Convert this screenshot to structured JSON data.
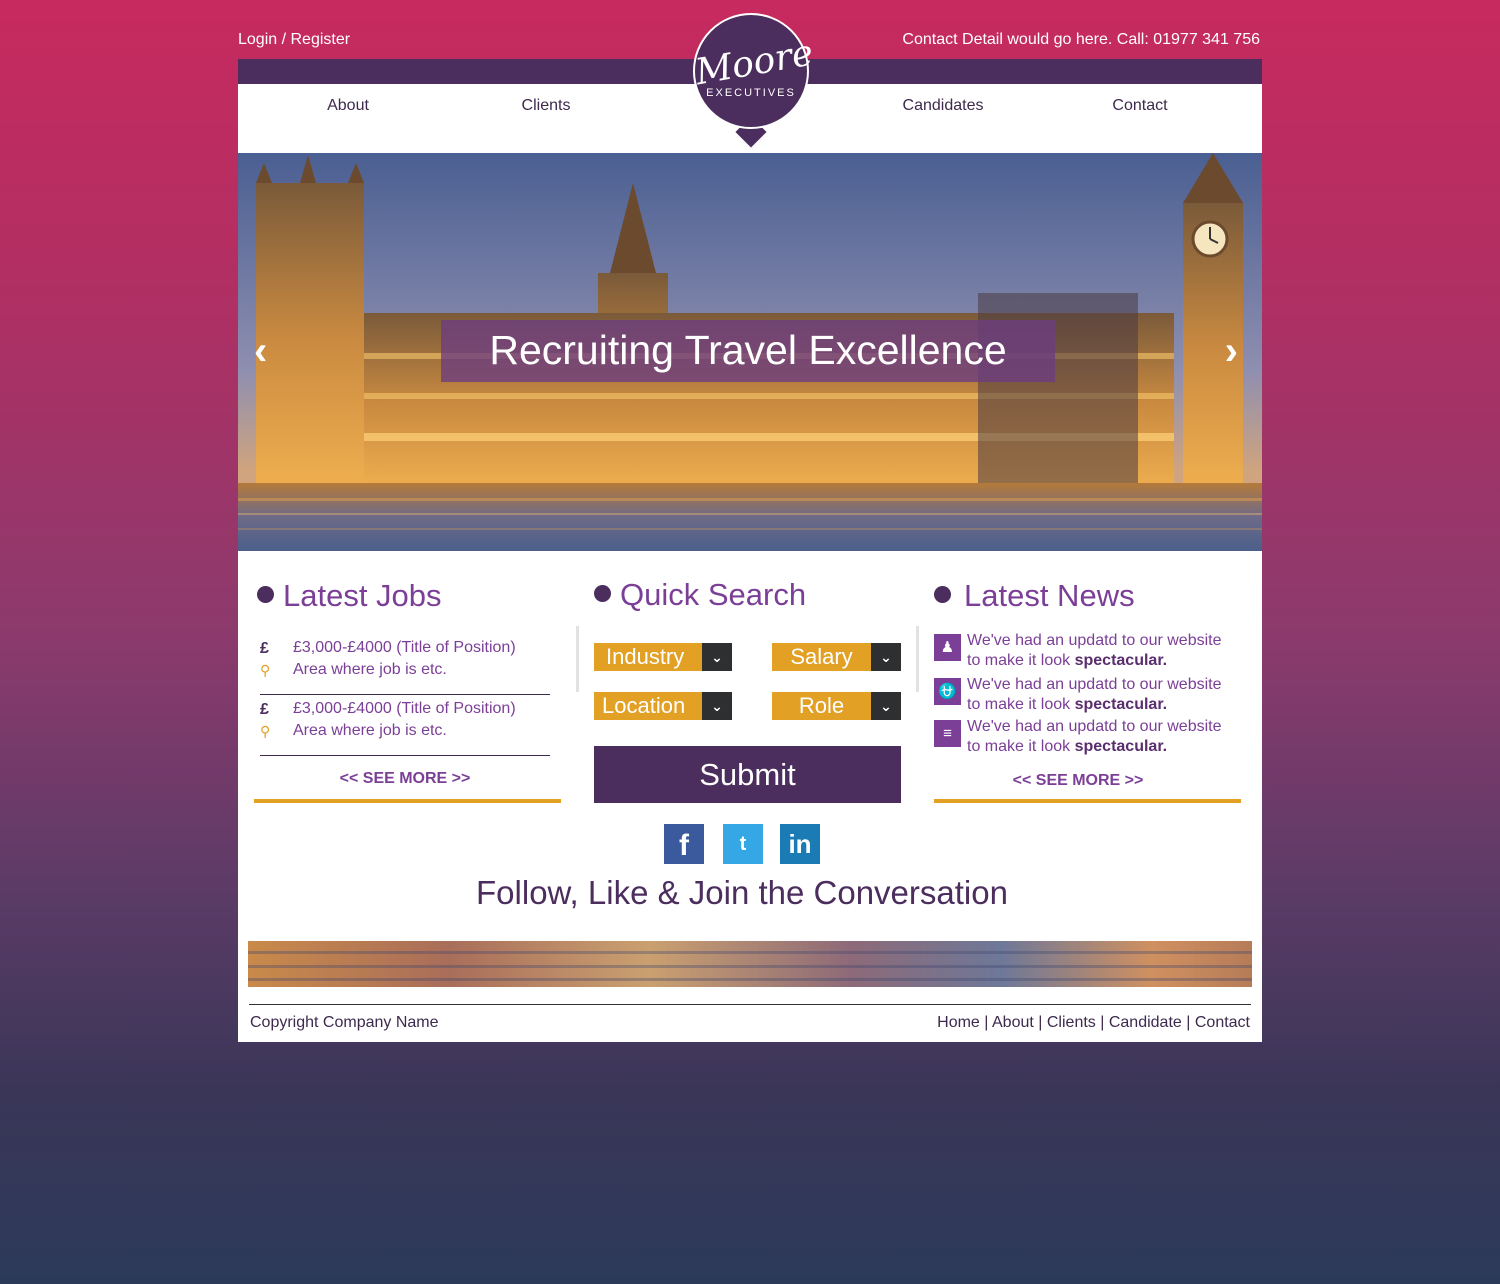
{
  "topbar": {
    "login": "Login / Register",
    "contact": "Contact Detail would go here. Call: 01977 341 756"
  },
  "logo": {
    "script": "Moore",
    "sub": "Executives"
  },
  "nav": [
    "About",
    "Clients",
    "Candidates",
    "Contact"
  ],
  "hero": {
    "caption": "Recruiting Travel Excellence",
    "prev": "‹",
    "next": "›"
  },
  "latest_jobs": {
    "title": "Latest Jobs",
    "jobs": [
      {
        "currency": "£",
        "title": "£3,000-£4000 (Title of Position)",
        "area": "Area where job is etc."
      },
      {
        "currency": "£",
        "title": "£3,000-£4000 (Title of Position)",
        "area": "Area where job is etc."
      }
    ],
    "see_more": "<< SEE MORE >>"
  },
  "quick_search": {
    "title": "Quick Search",
    "fields": [
      "Industry",
      "Salary",
      "Location",
      "Role"
    ],
    "submit": "Submit"
  },
  "latest_news": {
    "title": "Latest News",
    "items": [
      {
        "line1": "We've had an updatd to our website",
        "line2_prefix": "to make it look",
        "emphasis": "spectacular.",
        "icon": "user-icon"
      },
      {
        "line1": "We've had an updatd to our website",
        "line2_prefix": "to make it look",
        "emphasis": "spectacular.",
        "icon": "paperclip-icon"
      },
      {
        "line1": "We've had an updatd to our website",
        "line2_prefix": "to make it look",
        "emphasis": "spectacular.",
        "icon": "align-center-icon"
      }
    ],
    "see_more": "<< SEE MORE >>"
  },
  "social": {
    "facebook": "f",
    "twitter": "t",
    "linkedin": "in",
    "follow_text": "Follow, Like & Join the Conversation"
  },
  "footer": {
    "copyright": "Copyright Company Name",
    "links": [
      "Home",
      "About",
      "Clients",
      "Candidate",
      "Contact"
    ],
    "separator": "|"
  },
  "colors": {
    "purple_dark": "#4b2d5e",
    "purple_text": "#7b3f97",
    "gold": "#e2a025",
    "background_top": "#c72a5e",
    "background_bottom": "#2c3a5a"
  }
}
